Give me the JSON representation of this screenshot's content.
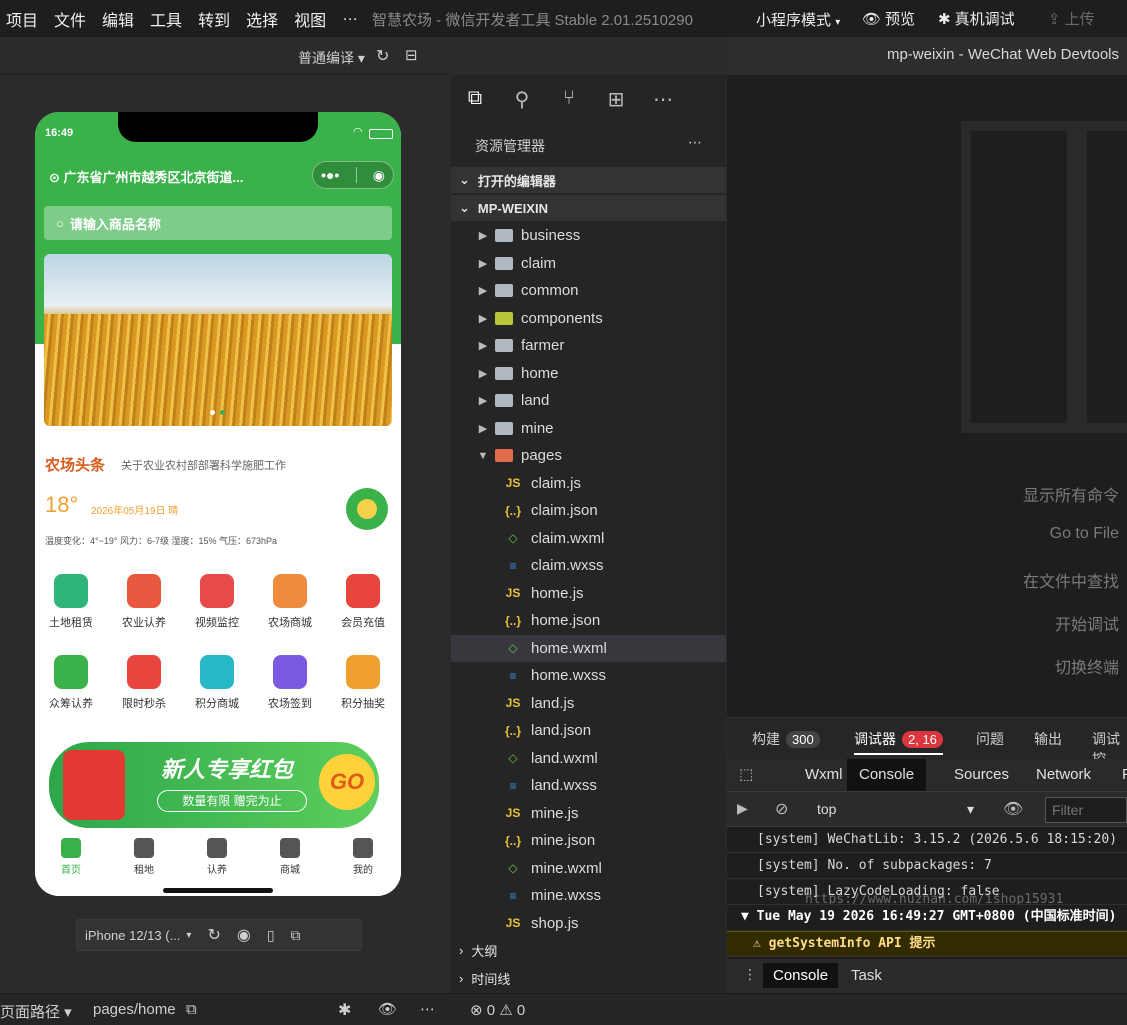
{
  "menu": [
    "项目",
    "文件",
    "编辑",
    "工具",
    "转到",
    "选择",
    "视图",
    "…"
  ],
  "app_title": "智慧农场 - 微信开发者工具 Stable 2.01.2510290",
  "toolbar": {
    "mode": "小程序模式",
    "preview": "预览",
    "real_debug": "真机调试",
    "upload": "上传"
  },
  "simulator": {
    "compile": "普通编译",
    "phone": {
      "time": "16:49",
      "location": "广东省广州市越秀区北京街道...",
      "search_placeholder": "请输入商品名称",
      "news_logo": "农场头条",
      "news_text": "关于农业农村部部署科学施肥工作",
      "temperature": "18°",
      "date": "2026年05月19日 晴",
      "weather_details": "温度变化：4°~19°    风力：6-7级    湿度：15%    气压：673hPa",
      "grid": [
        {
          "label": "土地租赁",
          "color": "#2fb57a"
        },
        {
          "label": "农业认养",
          "color": "#e9573f"
        },
        {
          "label": "视频监控",
          "color": "#e84a4a"
        },
        {
          "label": "农场商城",
          "color": "#f08a3c"
        },
        {
          "label": "会员充值",
          "color": "#e8453c"
        },
        {
          "label": "众筹认养",
          "color": "#3bb14a"
        },
        {
          "label": "限时秒杀",
          "color": "#e8453c"
        },
        {
          "label": "积分商城",
          "color": "#29b8c8"
        },
        {
          "label": "农场签到",
          "color": "#7a5ae0"
        },
        {
          "label": "积分抽奖",
          "color": "#f0a030"
        }
      ],
      "promo_title": "新人专享红包",
      "promo_sub": "数量有限 赠完为止",
      "promo_go": "GO",
      "tabs": [
        "首页",
        "租地",
        "认养",
        "商城",
        "我的"
      ]
    },
    "device": "iPhone 12/13 (..."
  },
  "explorer": {
    "title": "资源管理器",
    "open_editors": "打开的编辑器",
    "project": "MP-WEIXIN",
    "folders": [
      "business",
      "claim",
      "common",
      "components",
      "farmer",
      "home",
      "land",
      "mine",
      "pages"
    ],
    "files": [
      {
        "name": "claim.js",
        "type": "js"
      },
      {
        "name": "claim.json",
        "type": "json"
      },
      {
        "name": "claim.wxml",
        "type": "wxml"
      },
      {
        "name": "claim.wxss",
        "type": "wxss"
      },
      {
        "name": "home.js",
        "type": "js"
      },
      {
        "name": "home.json",
        "type": "json"
      },
      {
        "name": "home.wxml",
        "type": "wxml"
      },
      {
        "name": "home.wxss",
        "type": "wxss"
      },
      {
        "name": "land.js",
        "type": "js"
      },
      {
        "name": "land.json",
        "type": "json"
      },
      {
        "name": "land.wxml",
        "type": "wxml"
      },
      {
        "name": "land.wxss",
        "type": "wxss"
      },
      {
        "name": "mine.js",
        "type": "js"
      },
      {
        "name": "mine.json",
        "type": "json"
      },
      {
        "name": "mine.wxml",
        "type": "wxml"
      },
      {
        "name": "mine.wxss",
        "type": "wxss"
      },
      {
        "name": "shop.js",
        "type": "js"
      }
    ],
    "outline": "大纲",
    "timeline": "时间线"
  },
  "editor": {
    "tab_title": "mp-weixin - WeChat Web Devtools",
    "commands": [
      "显示所有命令",
      "Go to File",
      "在文件中查找",
      "开始调试",
      "切换终端"
    ]
  },
  "devtools": {
    "tabs": [
      {
        "label": "构建",
        "badge": "300"
      },
      {
        "label": "调试器",
        "badge": "2, 16"
      },
      {
        "label": "问题",
        "badge": ""
      },
      {
        "label": "输出",
        "badge": ""
      },
      {
        "label": "调试控",
        "badge": ""
      }
    ],
    "subtabs": [
      "Wxml",
      "Console",
      "Sources",
      "Network",
      "Pe"
    ],
    "context": "top",
    "filter_placeholder": "Filter",
    "logs": [
      "[system] WeChatLib: 3.15.2 (2026.5.6 18:15:20)",
      "[system] No. of subpackages: 7",
      "[system] LazyCodeLoading: false"
    ],
    "group_header": "Tue May 19 2026 16:49:27 GMT+0800 (中国标准时间)",
    "warning": "getSystemInfo API 提示",
    "bottom_tabs": [
      "Console",
      "Task"
    ]
  },
  "statusbar": {
    "path_label": "页面路径",
    "path": "pages/home",
    "errors": "0",
    "warnings": "0"
  }
}
